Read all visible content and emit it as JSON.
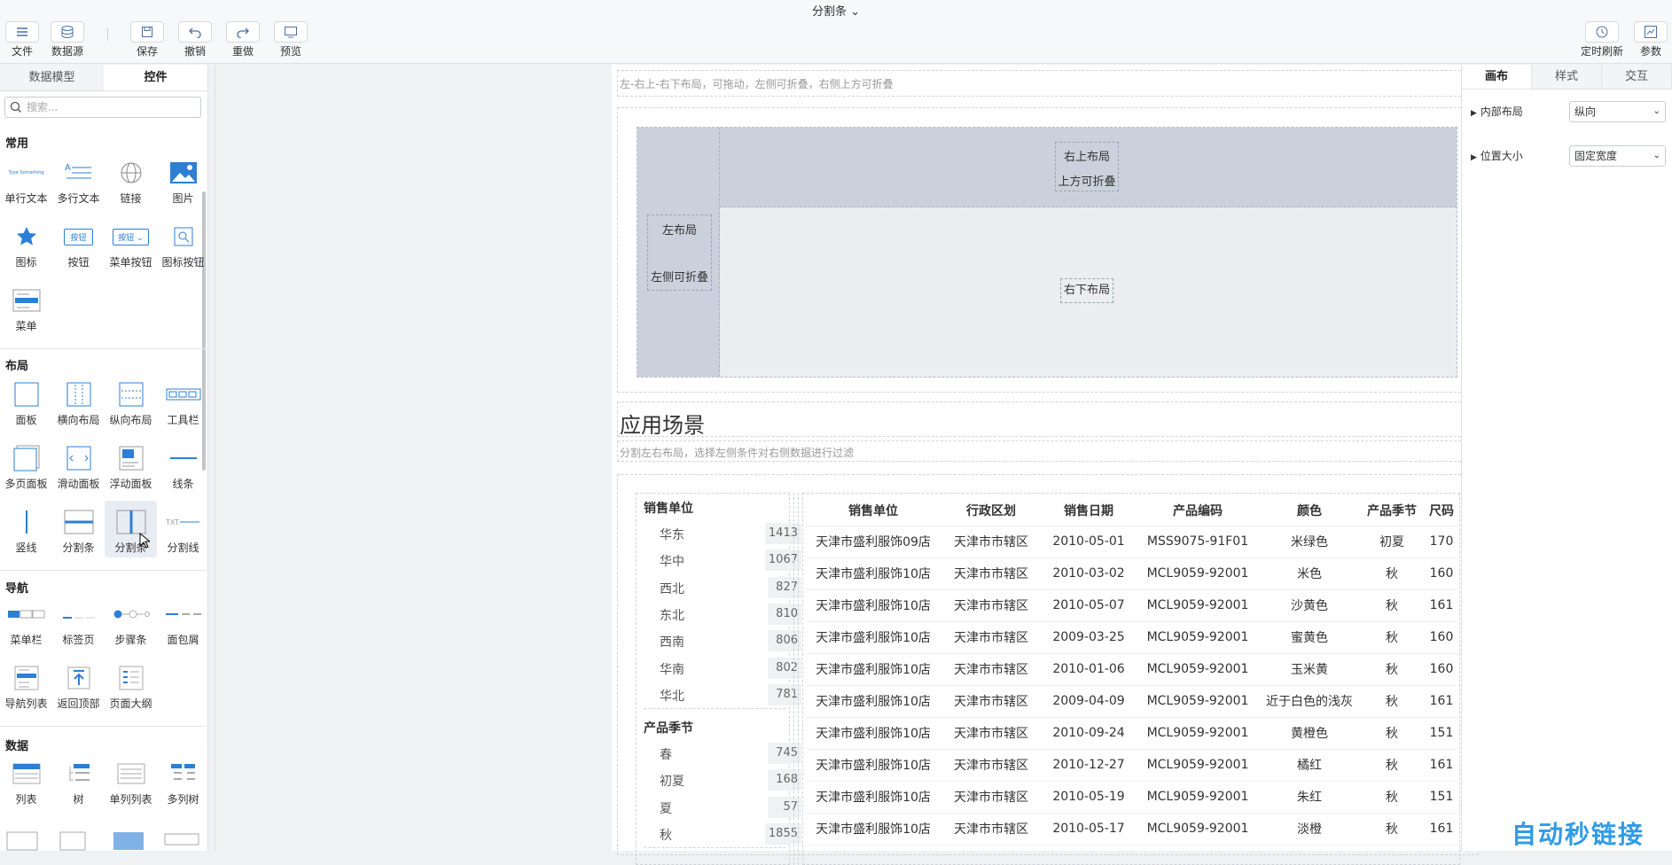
{
  "app": {
    "title": "分割条"
  },
  "toolbar": {
    "file": "文件",
    "datasource": "数据源",
    "save": "保存",
    "undo": "撤销",
    "redo": "重做",
    "preview": "预览",
    "timed_refresh": "定时刷新",
    "params": "参数"
  },
  "left_panel": {
    "tabs": [
      "数据模型",
      "控件"
    ],
    "search_placeholder": "搜索...",
    "sections": {
      "common": "常用",
      "layout": "布局",
      "nav": "导航",
      "data": "数据"
    },
    "common_widgets": [
      "单行文本",
      "多行文本",
      "链接",
      "图片",
      "图标",
      "按钮",
      "菜单按钮",
      "图标按钮",
      "菜单"
    ],
    "layout_widgets": [
      "面板",
      "横向布局",
      "纵向布局",
      "工具栏",
      "多页面板",
      "滑动面板",
      "浮动面板",
      "线条",
      "竖线",
      "分割条",
      "分割条",
      "分割线"
    ],
    "nav_widgets": [
      "菜单栏",
      "标签页",
      "步骤条",
      "面包屑",
      "导航列表",
      "返回顶部",
      "页面大纲"
    ],
    "data_widgets": [
      "列表",
      "树",
      "单列列表",
      "多列树"
    ],
    "icon_texts": {
      "type_something": "Type Something",
      "button": "按钮",
      "menu_button": "按钮",
      "txt": "TXT"
    }
  },
  "canvas": {
    "desc1": "左-右上-右下布局，可拖动，左侧可折叠，右侧上方可折叠",
    "left_layout_1": "左布局",
    "left_layout_2": "左侧可折叠",
    "top_right_1": "右上布局",
    "top_right_2": "上方可折叠",
    "bottom_right": "右下布局",
    "heading": "应用场景",
    "desc2": "分割左右布局，选择左侧条件对右侧数据进行过滤",
    "filter_groups": [
      {
        "title": "销售单位",
        "items": [
          {
            "label": "华东",
            "count": "1413"
          },
          {
            "label": "华中",
            "count": "1067"
          },
          {
            "label": "西北",
            "count": "827"
          },
          {
            "label": "东北",
            "count": "810"
          },
          {
            "label": "西南",
            "count": "806"
          },
          {
            "label": "华南",
            "count": "802"
          },
          {
            "label": "华北",
            "count": "781"
          }
        ]
      },
      {
        "title": "产品季节",
        "items": [
          {
            "label": "春",
            "count": "745"
          },
          {
            "label": "初夏",
            "count": "168"
          },
          {
            "label": "夏",
            "count": "57"
          },
          {
            "label": "秋",
            "count": "1855"
          }
        ]
      }
    ],
    "table": {
      "headers": [
        "销售单位",
        "行政区划",
        "销售日期",
        "产品编码",
        "颜色",
        "产品季节",
        "尺码"
      ],
      "rows": [
        [
          "天津市盛利服饰09店",
          "天津市市辖区",
          "2010-05-01",
          "MSS9075-91F01",
          "米绿色",
          "初夏",
          "170"
        ],
        [
          "天津市盛利服饰10店",
          "天津市市辖区",
          "2010-03-02",
          "MCL9059-92001",
          "米色",
          "秋",
          "160"
        ],
        [
          "天津市盛利服饰10店",
          "天津市市辖区",
          "2010-05-07",
          "MCL9059-92001",
          "沙黄色",
          "秋",
          "161"
        ],
        [
          "天津市盛利服饰10店",
          "天津市市辖区",
          "2009-03-25",
          "MCL9059-92001",
          "蜜黄色",
          "秋",
          "160"
        ],
        [
          "天津市盛利服饰10店",
          "天津市市辖区",
          "2010-01-06",
          "MCL9059-92001",
          "玉米黄",
          "秋",
          "160"
        ],
        [
          "天津市盛利服饰10店",
          "天津市市辖区",
          "2009-04-09",
          "MCL9059-92001",
          "近于白色的浅灰",
          "秋",
          "161"
        ],
        [
          "天津市盛利服饰10店",
          "天津市市辖区",
          "2010-09-24",
          "MCL9059-92001",
          "黄橙色",
          "秋",
          "151"
        ],
        [
          "天津市盛利服饰10店",
          "天津市市辖区",
          "2010-12-27",
          "MCL9059-92001",
          "橘红",
          "秋",
          "161"
        ],
        [
          "天津市盛利服饰10店",
          "天津市市辖区",
          "2010-05-19",
          "MCL9059-92001",
          "朱红",
          "秋",
          "151"
        ],
        [
          "天津市盛利服饰10店",
          "天津市市辖区",
          "2010-05-17",
          "MCL9059-92001",
          "淡橙",
          "秋",
          "161"
        ]
      ]
    }
  },
  "right_panel": {
    "tabs": [
      "画布",
      "样式",
      "交互"
    ],
    "props": [
      {
        "label": "内部布局",
        "value": "纵向"
      },
      {
        "label": "位置大小",
        "value": "固定宽度"
      }
    ]
  },
  "watermark": "自动秒链接"
}
